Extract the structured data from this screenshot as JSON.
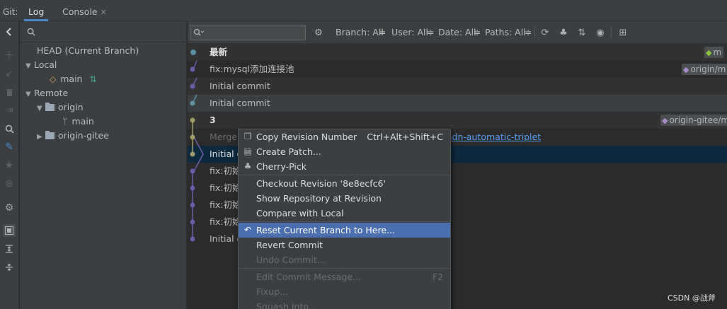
{
  "app": {
    "tool_window_title": "Git:",
    "tabs": [
      {
        "label": "Log"
      },
      {
        "label": "Console",
        "close": "✕"
      }
    ]
  },
  "branches": {
    "search_icon": "search-icon",
    "head": "HEAD (Current Branch)",
    "local_label": "Local",
    "local_main": "main",
    "remote_label": "Remote",
    "origin": "origin",
    "origin_main": "main",
    "origin_gitee": "origin-gitee"
  },
  "toolbar": {
    "filter_placeholder": "",
    "branch_filter": "Branch: All",
    "user_filter": "User: All",
    "date_filter": "Date: All",
    "paths_filter": "Paths: All"
  },
  "commits": [
    {
      "message": "最新",
      "ref": "m",
      "ref_color": "#8cc23f"
    },
    {
      "message": "fix:mysql添加连接池",
      "ref": "origin/m"
    },
    {
      "message": "Initial commit",
      "ref": ""
    },
    {
      "message": "Initial commit",
      "ref": ""
    },
    {
      "message": "3",
      "ref": "origin-gitee/m"
    },
    {
      "message": "Merge",
      "link": "sdn-automatic-triplet"
    },
    {
      "message": "Initial c"
    },
    {
      "message": "fix:初始"
    },
    {
      "message": "fix:初始"
    },
    {
      "message": "fix:初始"
    },
    {
      "message": "fix:初始"
    },
    {
      "message": "Initial c"
    }
  ],
  "context_menu": {
    "copy_revision": {
      "label": "Copy Revision Number",
      "shortcut": "Ctrl+Alt+Shift+C"
    },
    "create_patch": {
      "label": "Create Patch..."
    },
    "cherry_pick": {
      "label": "Cherry-Pick"
    },
    "checkout_revision": {
      "label": "Checkout Revision '8e8ecfc6'"
    },
    "show_repository": {
      "label": "Show Repository at Revision"
    },
    "compare_local": {
      "label": "Compare with Local"
    },
    "reset_branch": {
      "label": "Reset Current Branch to Here..."
    },
    "revert_commit": {
      "label": "Revert Commit"
    },
    "undo_commit": {
      "label": "Undo Commit..."
    },
    "edit_message": {
      "label": "Edit Commit Message...",
      "shortcut": "F2"
    },
    "fixup": {
      "label": "Fixup..."
    },
    "squash": {
      "label": "Squash Into..."
    }
  },
  "watermark": "CSDN @战斧",
  "colors": {
    "accent": "#4a88c7",
    "selection": "#4b6eaf",
    "graph_purple": "#6e5ba8",
    "graph_teal": "#5a8fa6",
    "graph_olive": "#a09b6a",
    "link": "#589df6"
  }
}
